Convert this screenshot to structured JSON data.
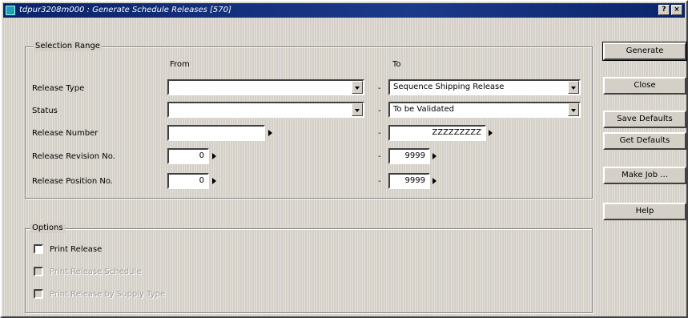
{
  "window": {
    "title": "tdpur3208m000 : Generate Schedule Releases [570]",
    "help_glyph": "?",
    "close_glyph": "×"
  },
  "selection_range": {
    "title": "Selection Range",
    "from_header": "From",
    "to_header": "To",
    "range_separator": "-",
    "rows": [
      {
        "label": "Release Type",
        "from": "",
        "to": "Sequence Shipping Release"
      },
      {
        "label": "Status",
        "from": "",
        "to": "To be Validated"
      },
      {
        "label": "Release Number",
        "from": "",
        "to": "ZZZZZZZZZ"
      },
      {
        "label": "Release Revision No.",
        "from": "0",
        "to": "9999"
      },
      {
        "label": "Release Position No.",
        "from": "0",
        "to": "9999"
      }
    ]
  },
  "options": {
    "title": "Options",
    "items": [
      {
        "label": "Print Release",
        "enabled": true,
        "checked": false
      },
      {
        "label": "Print Release Schedule",
        "enabled": false,
        "checked": false
      },
      {
        "label": "Print Release by Supply Type",
        "enabled": false,
        "checked": false
      }
    ]
  },
  "buttons": {
    "generate": "Generate",
    "close": "Close",
    "save_defaults": "Save Defaults",
    "get_defaults": "Get Defaults",
    "make_job": "Make Job ...",
    "help": "Help"
  }
}
